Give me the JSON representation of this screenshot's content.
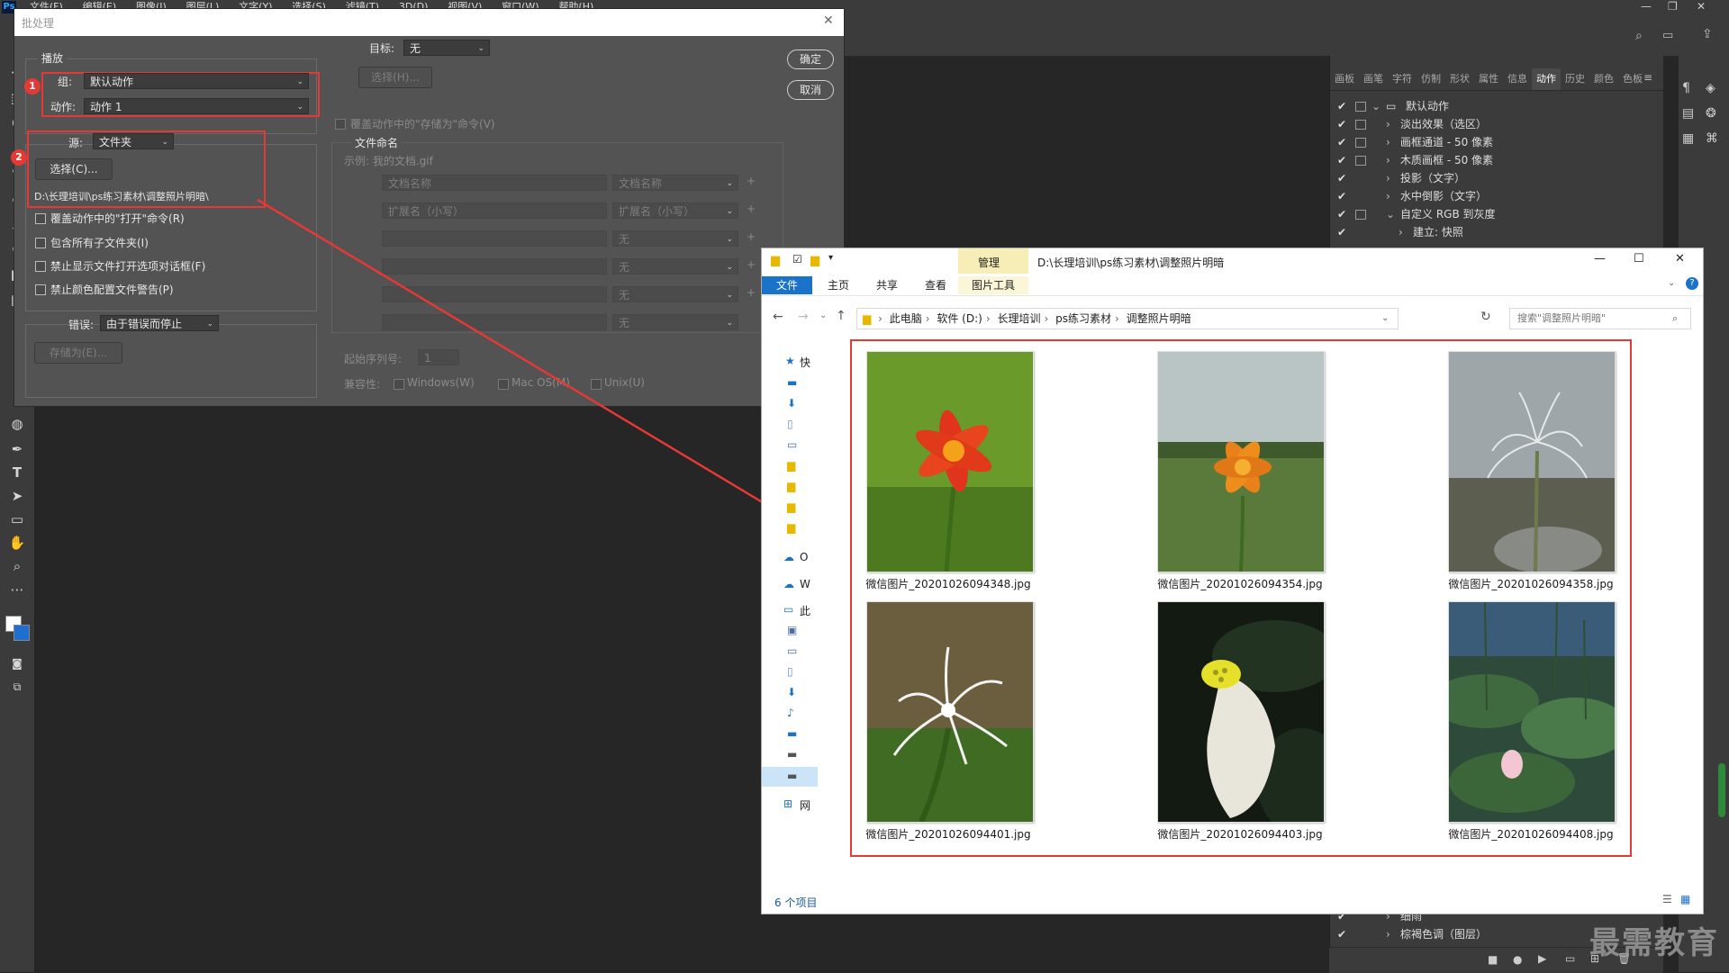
{
  "ps": {
    "menu": [
      "文件(F)",
      "编辑(E)",
      "图像(I)",
      "图层(L)",
      "文字(Y)",
      "选择(S)",
      "滤镜(T)",
      "3D(D)",
      "视图(V)",
      "窗口(W)",
      "帮助(H)"
    ],
    "panel_tabs": [
      "画板",
      "画笔",
      "字符",
      "仿制",
      "形状",
      "属性",
      "信息",
      "动作",
      "历史",
      "颜色",
      "色板"
    ],
    "active_tab": "动作",
    "actions": [
      {
        "text": "默认动作",
        "level": 0,
        "type": "folder"
      },
      {
        "text": "淡出效果（选区）",
        "level": 1
      },
      {
        "text": "画框通道 - 50 像素",
        "level": 1
      },
      {
        "text": "木质画框 - 50 像素",
        "level": 1
      },
      {
        "text": "投影（文字）",
        "level": 1
      },
      {
        "text": "水中倒影（文字）",
        "level": 1
      },
      {
        "text": "自定义 RGB 到灰度",
        "level": 1,
        "expanded": true
      },
      {
        "text": "建立: 快照",
        "level": 2
      }
    ],
    "actions_bottom": [
      {
        "text": "细雨",
        "level": 1
      },
      {
        "text": "棕褐色调（图层）",
        "level": 1
      }
    ]
  },
  "batch": {
    "title": "批处理",
    "play_legend": "播放",
    "group_label": "组:",
    "group_value": "默认动作",
    "action_label": "动作:",
    "action_value": "动作 1",
    "source_label": "源:",
    "source_value": "文件夹",
    "choose_button": "选择(C)...",
    "source_path": "D:\\长理培训\\ps练习素材\\调整照片明暗\\",
    "checkboxes": [
      "覆盖动作中的\"打开\"命令(R)",
      "包含所有子文件夹(I)",
      "禁止显示文件打开选项对话框(F)",
      "禁止颜色配置文件警告(P)"
    ],
    "error_label": "错误:",
    "error_value": "由于错误而停止",
    "save_as_button": "存储为(E)...",
    "target_label": "目标:",
    "target_value": "无",
    "target_choose": "选择(H)...",
    "override_save": "覆盖动作中的\"存储为\"命令(V)",
    "naming_legend": "文件命名",
    "example": "示例: 我的文档.gif",
    "naming_fields": [
      [
        "文档名称",
        "文档名称"
      ],
      [
        "扩展名（小写）",
        "扩展名（小写）"
      ],
      [
        "",
        "无"
      ],
      [
        "",
        "无"
      ],
      [
        "",
        "无"
      ],
      [
        "",
        "无"
      ]
    ],
    "plus": "+",
    "start_serial_label": "起始序列号:",
    "start_serial_value": "1",
    "compat_label": "兼容性:",
    "compat": [
      "Windows(W)",
      "Mac OS(M)",
      "Unix(U)"
    ],
    "ok": "确定",
    "cancel": "取消",
    "badge1": "1",
    "badge2": "2"
  },
  "explorer": {
    "title": "D:\\长理培训\\ps练习素材\\调整照片明暗",
    "manage_tab": "管理",
    "ribbon_tabs": [
      "文件",
      "主页",
      "共享",
      "查看"
    ],
    "picture_tools": "图片工具",
    "breadcrumb": [
      "此电脑",
      "软件 (D:)",
      "长理培训",
      "ps练习素材",
      "调整照片明暗"
    ],
    "search_placeholder": "搜索\"调整照片明暗\"",
    "nav_items": [
      "快",
      "",
      "",
      "",
      "",
      "",
      "",
      "",
      "",
      "O",
      "W",
      "此",
      "",
      "",
      "",
      "",
      "",
      "",
      "",
      "网"
    ],
    "files": [
      "微信图片_20201026094348.jpg",
      "微信图片_20201026094354.jpg",
      "微信图片_20201026094358.jpg",
      "微信图片_20201026094401.jpg",
      "微信图片_20201026094403.jpg",
      "微信图片_20201026094408.jpg"
    ],
    "status": "6 个项目",
    "window_buttons": [
      "—",
      "☐",
      "✕"
    ]
  },
  "watermark": "最需教育",
  "colors": {
    "highlight_red": "#e53935",
    "explorer_accent": "#1a73c9",
    "ps_bg": "#262626"
  }
}
